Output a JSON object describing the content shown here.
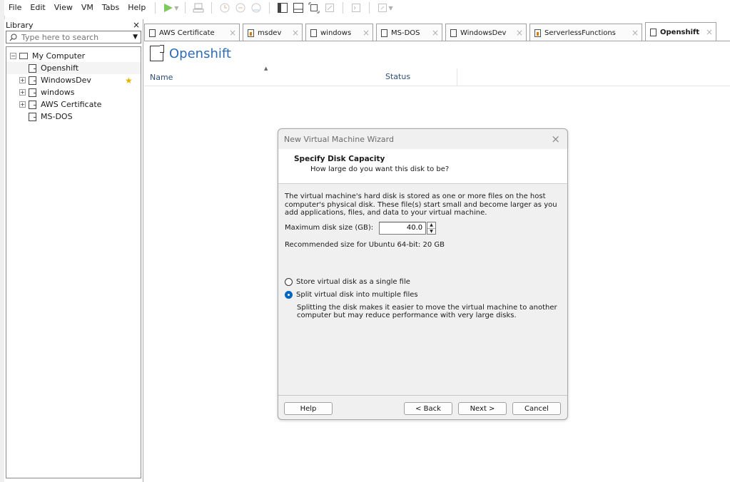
{
  "menu": [
    "File",
    "Edit",
    "View",
    "VM",
    "Tabs",
    "Help"
  ],
  "toolbar_icons": [
    "play-icon",
    "send-keys-icon",
    "snapshot-icon",
    "revert-snapshot-icon",
    "snapshot-manager-icon",
    "library-view-icon",
    "thumbnail-bar-icon",
    "fit-window-icon",
    "fullscreen-icon",
    "console-view-icon",
    "stretch-icon"
  ],
  "library": {
    "title": "Library",
    "close": "×",
    "search_placeholder": "Type here to search",
    "root": "My Computer",
    "items": [
      "Openshift",
      "WindowsDev",
      "windows",
      "AWS Certificate",
      "MS-DOS"
    ]
  },
  "tabs": [
    {
      "label": "AWS Certificate",
      "icon": "vm-icon"
    },
    {
      "label": "msdev",
      "icon": "vm-orange-icon"
    },
    {
      "label": "windows",
      "icon": "vm-icon"
    },
    {
      "label": "MS-DOS",
      "icon": "vm-icon"
    },
    {
      "label": "WindowsDev",
      "icon": "vm-icon"
    },
    {
      "label": "ServerlessFunctions",
      "icon": "vm-orange-icon"
    },
    {
      "label": "Openshift",
      "icon": "vm-icon",
      "active": true
    }
  ],
  "tab_close": "×",
  "main": {
    "title": "Openshift",
    "col_name": "Name",
    "col_status": "Status"
  },
  "dialog": {
    "title": "New Virtual Machine Wizard",
    "close": "×",
    "heading": "Specify Disk Capacity",
    "subheading": "How large do you want this disk to be?",
    "description": "The virtual machine's hard disk is stored as one or more files on the host computer's physical disk. These file(s) start small and become larger as you add applications, files, and data to your virtual machine.",
    "size_label": "Maximum disk size (GB):",
    "size_value": "40.0",
    "recommended": "Recommended size for Ubuntu 64-bit: 20 GB",
    "radio_single": "Store virtual disk as a single file",
    "radio_split": "Split virtual disk into multiple files",
    "split_description": "Splitting the disk makes it easier to move the virtual machine to another computer but may reduce performance with very large disks.",
    "selected_option": "split",
    "buttons": {
      "help": "Help",
      "back": "< Back",
      "next": "Next >",
      "cancel": "Cancel"
    }
  },
  "colors": {
    "accent": "#0067c0",
    "title_blue": "#2d6bb5",
    "star": "#e6b400",
    "snapshot_orange": "#e07b00"
  }
}
